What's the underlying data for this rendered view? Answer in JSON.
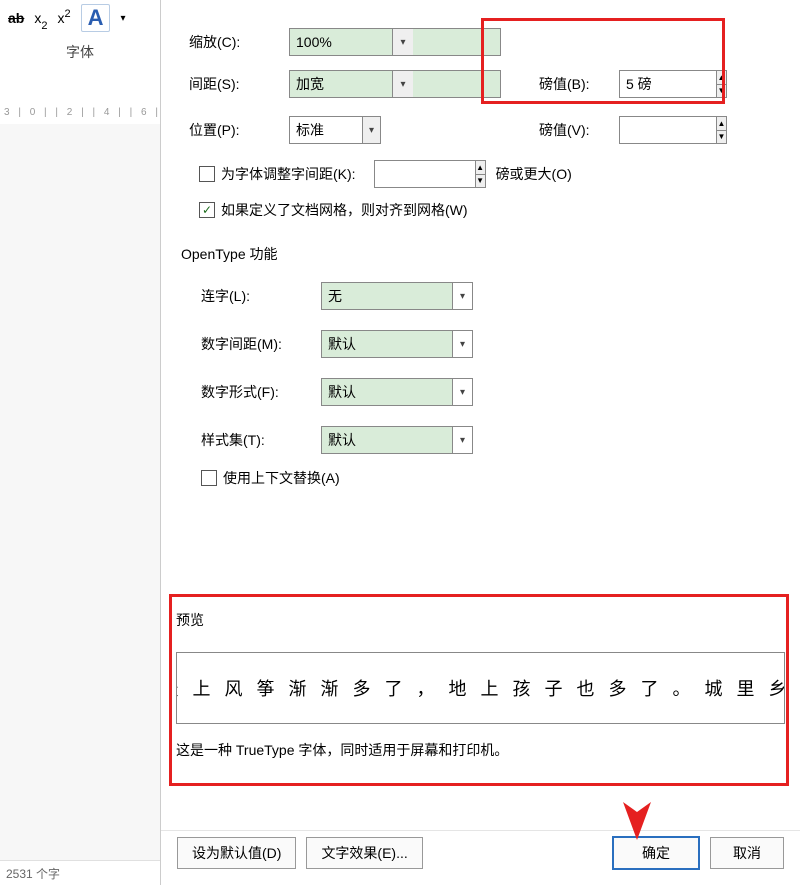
{
  "ribbon": {
    "sub_label": "x",
    "sup_label": "x",
    "clear_fmt": "A",
    "group_label": "字体",
    "ruler_marks": "3   | 0 |   | 2 |   | 4 |   | 6 |"
  },
  "status": {
    "text": "2531 个字"
  },
  "dialog": {
    "scale": {
      "label": "缩放(C):",
      "value": "100%"
    },
    "spacing": {
      "label": "间距(S):",
      "value": "加宽"
    },
    "points": {
      "label": "磅值(B):",
      "value": "5 磅"
    },
    "position": {
      "label": "位置(P):",
      "value": "标准"
    },
    "points2": {
      "label": "磅值(V):",
      "value": ""
    },
    "kerning": {
      "label": "为字体调整字间距(K):",
      "value": "",
      "suffix": "磅或更大(O)"
    },
    "snapgrid": {
      "label": "如果定义了文档网格，则对齐到网格(W)",
      "checked": true
    },
    "opentype_title": "OpenType 功能",
    "ligatures": {
      "label": "连字(L):",
      "value": "无"
    },
    "num_spacing": {
      "label": "数字间距(M):",
      "value": "默认"
    },
    "num_form": {
      "label": "数字形式(F):",
      "value": "默认"
    },
    "styleset": {
      "label": "样式集(T):",
      "value": "默认"
    },
    "contextual": {
      "label": "使用上下文替换(A)",
      "checked": false
    },
    "preview_title": "预览",
    "preview_text": "天上风筝渐渐多了，地上孩子也多了。城里乡",
    "preview_note": "这是一种 TrueType 字体，同时适用于屏幕和打印机。",
    "btn_default": "设为默认值(D)",
    "btn_effects": "文字效果(E)...",
    "btn_ok": "确定",
    "btn_cancel": "取消"
  }
}
